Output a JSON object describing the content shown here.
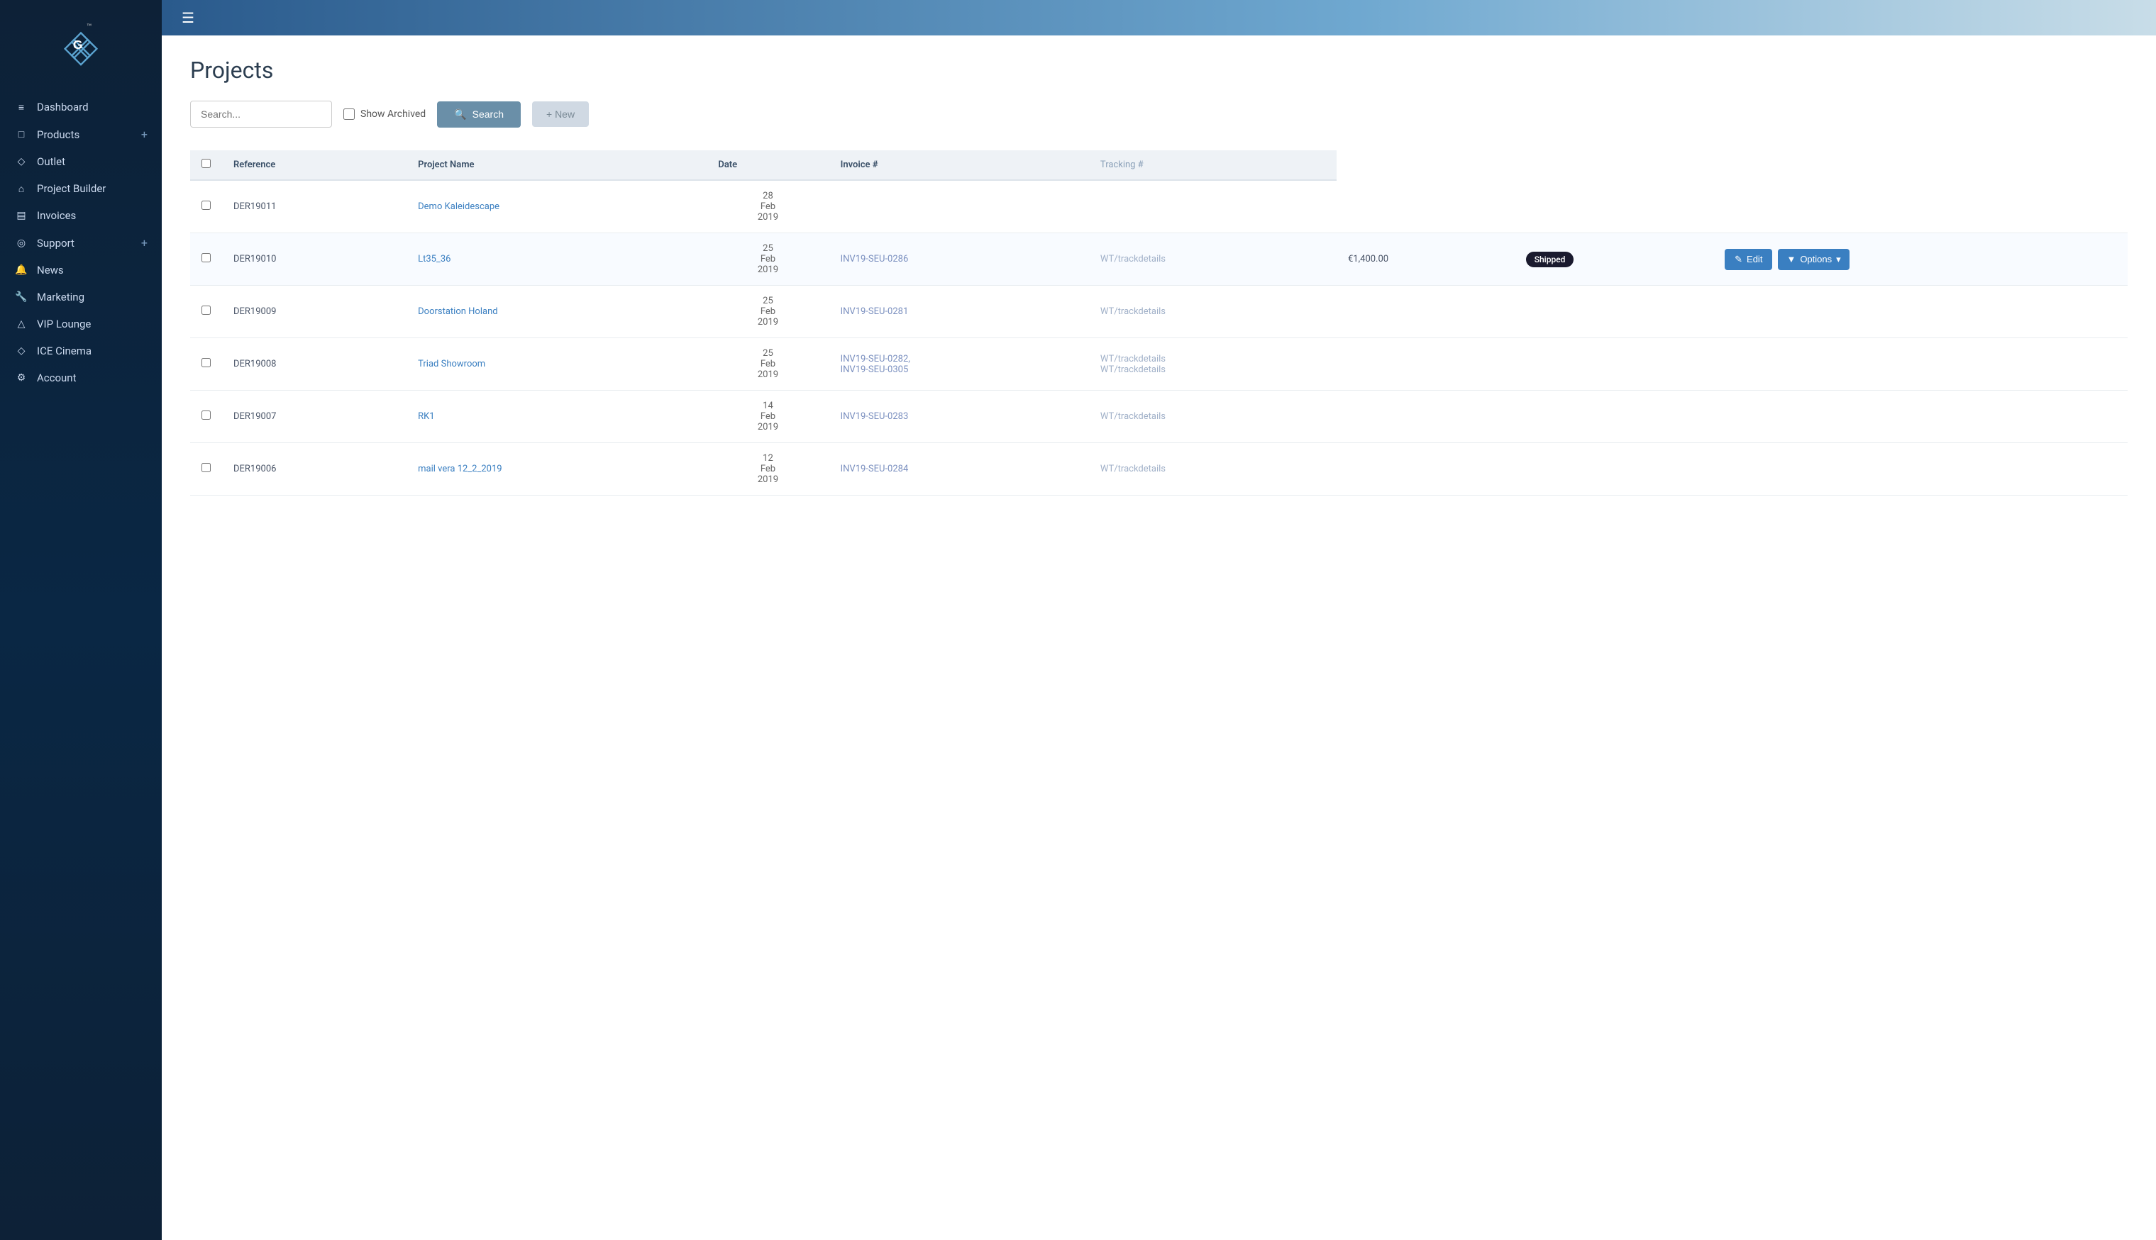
{
  "sidebar": {
    "logo_alt": "GQ Logo",
    "nav_items": [
      {
        "id": "dashboard",
        "label": "Dashboard",
        "icon": "≡",
        "has_plus": false
      },
      {
        "id": "products",
        "label": "Products",
        "icon": "□",
        "has_plus": true
      },
      {
        "id": "outlet",
        "label": "Outlet",
        "icon": "◇",
        "has_plus": false
      },
      {
        "id": "project-builder",
        "label": "Project Builder",
        "icon": "⌂",
        "has_plus": false
      },
      {
        "id": "invoices",
        "label": "Invoices",
        "icon": "▤",
        "has_plus": false
      },
      {
        "id": "support",
        "label": "Support",
        "icon": "◎",
        "has_plus": true
      },
      {
        "id": "news",
        "label": "News",
        "icon": "🔔",
        "has_plus": false
      },
      {
        "id": "marketing",
        "label": "Marketing",
        "icon": "🔧",
        "has_plus": false
      },
      {
        "id": "vip-lounge",
        "label": "VIP Lounge",
        "icon": "△",
        "has_plus": false
      },
      {
        "id": "ice-cinema",
        "label": "ICE Cinema",
        "icon": "◇",
        "has_plus": false
      },
      {
        "id": "account",
        "label": "Account",
        "icon": "⚙",
        "has_plus": false
      }
    ]
  },
  "page": {
    "title": "Projects"
  },
  "toolbar": {
    "search_placeholder": "Search...",
    "show_archived_label": "Show Archived",
    "search_button_label": "Search",
    "add_button_label": "+ New"
  },
  "table": {
    "columns": [
      {
        "id": "checkbox",
        "label": ""
      },
      {
        "id": "reference",
        "label": "Reference"
      },
      {
        "id": "project_name",
        "label": "Project Name"
      },
      {
        "id": "date",
        "label": "Date"
      },
      {
        "id": "invoice",
        "label": "Invoice #"
      },
      {
        "id": "tracking",
        "label": "Tracking #"
      }
    ],
    "rows": [
      {
        "id": "row-1",
        "reference": "DER19011",
        "project_name": "Demo Kaleidescape",
        "date": "28 Feb 2019",
        "invoice": "",
        "tracking": "",
        "amount": "",
        "status": "",
        "expanded": false
      },
      {
        "id": "row-2",
        "reference": "DER19010",
        "project_name": "Lt35_36",
        "date": "25 Feb 2019",
        "invoice": "INV19-SEU-0286",
        "tracking": "WT/trackdetails",
        "amount": "€1,400.00",
        "status": "Shipped",
        "expanded": true
      },
      {
        "id": "row-3",
        "reference": "DER19009",
        "project_name": "Doorstation Holand",
        "date": "25 Feb 2019",
        "invoice": "INV19-SEU-0281",
        "tracking": "WT/trackdetails",
        "amount": "",
        "status": "",
        "expanded": false
      },
      {
        "id": "row-4",
        "reference": "DER19008",
        "project_name": "Triad Showroom",
        "date": "25 Feb 2019",
        "invoice": "INV19-SEU-0282, INV19-SEU-0305",
        "tracking": "WT/trackdetails WT/trackdetails",
        "amount": "",
        "status": "",
        "expanded": false
      },
      {
        "id": "row-5",
        "reference": "DER19007",
        "project_name": "RK1",
        "date": "14 Feb 2019",
        "invoice": "INV19-SEU-0283",
        "tracking": "WT/trackdetails",
        "amount": "",
        "status": "",
        "expanded": false
      },
      {
        "id": "row-6",
        "reference": "DER19006",
        "project_name": "mail vera 12_2_2019",
        "date": "12 Feb 2019",
        "invoice": "INV19-SEU-0284",
        "tracking": "WT/trackdetails",
        "amount": "",
        "status": "",
        "expanded": false
      }
    ],
    "edit_label": "Edit",
    "options_label": "Options"
  }
}
